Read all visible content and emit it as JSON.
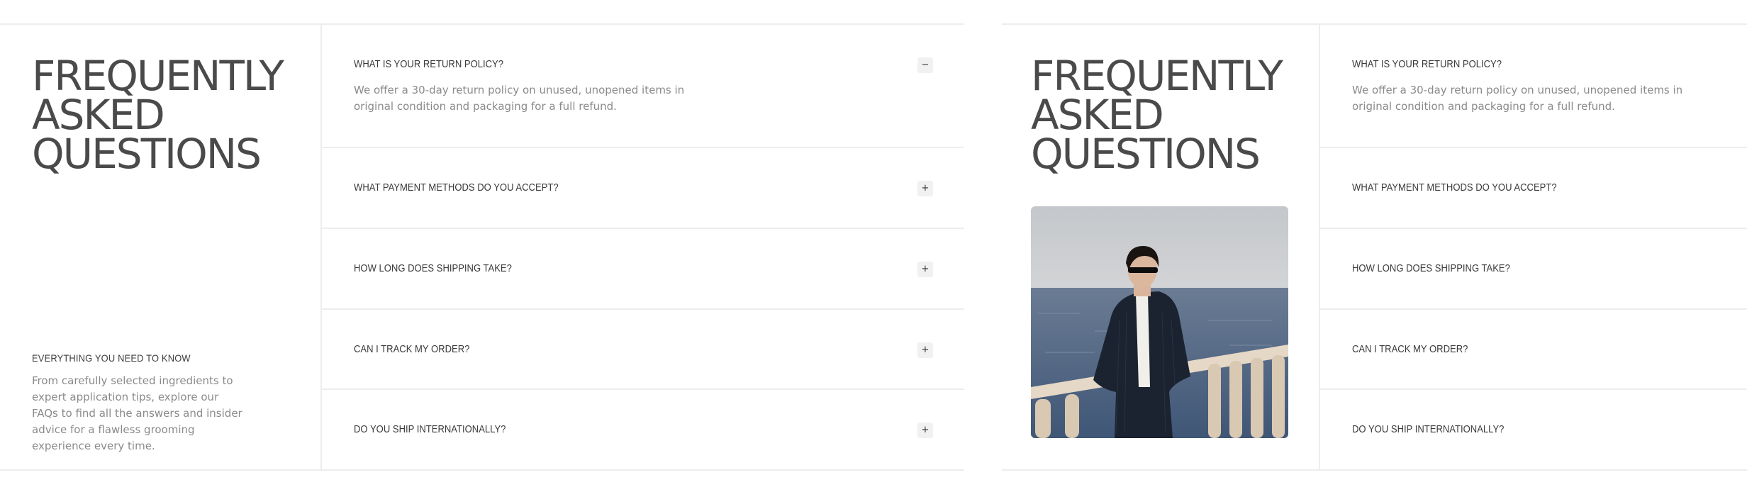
{
  "faq": {
    "heading_lines": [
      "FREQUENTLY",
      "ASKED",
      "QUESTIONS"
    ],
    "intro_title": "EVERYTHING YOU NEED TO KNOW",
    "intro_text": "From carefully selected ingredients to expert application tips, explore our FAQs to find all the answers and insider advice for a flawless grooming experience every time.",
    "items": [
      {
        "question": "WHAT IS YOUR RETURN POLICY?",
        "answer": "We offer a 30-day return policy on unused, unopened items in original condition and packaging for a full refund.",
        "expanded": true,
        "toggle": "−"
      },
      {
        "question": "WHAT PAYMENT METHODS DO YOU ACCEPT?",
        "answer": "",
        "expanded": false,
        "toggle": "+"
      },
      {
        "question": "HOW LONG DOES SHIPPING TAKE?",
        "answer": "",
        "expanded": false,
        "toggle": "+"
      },
      {
        "question": "CAN I TRACK MY ORDER?",
        "answer": "",
        "expanded": false,
        "toggle": "+"
      },
      {
        "question": "DO YOU SHIP INTERNATIONALLY?",
        "answer": "",
        "expanded": false,
        "toggle": "+"
      }
    ]
  },
  "colors": {
    "heading": "#4a4a4a",
    "body_text": "#8a8a8a",
    "divider": "#ededed",
    "toggle_bg": "#f1f1f1"
  }
}
